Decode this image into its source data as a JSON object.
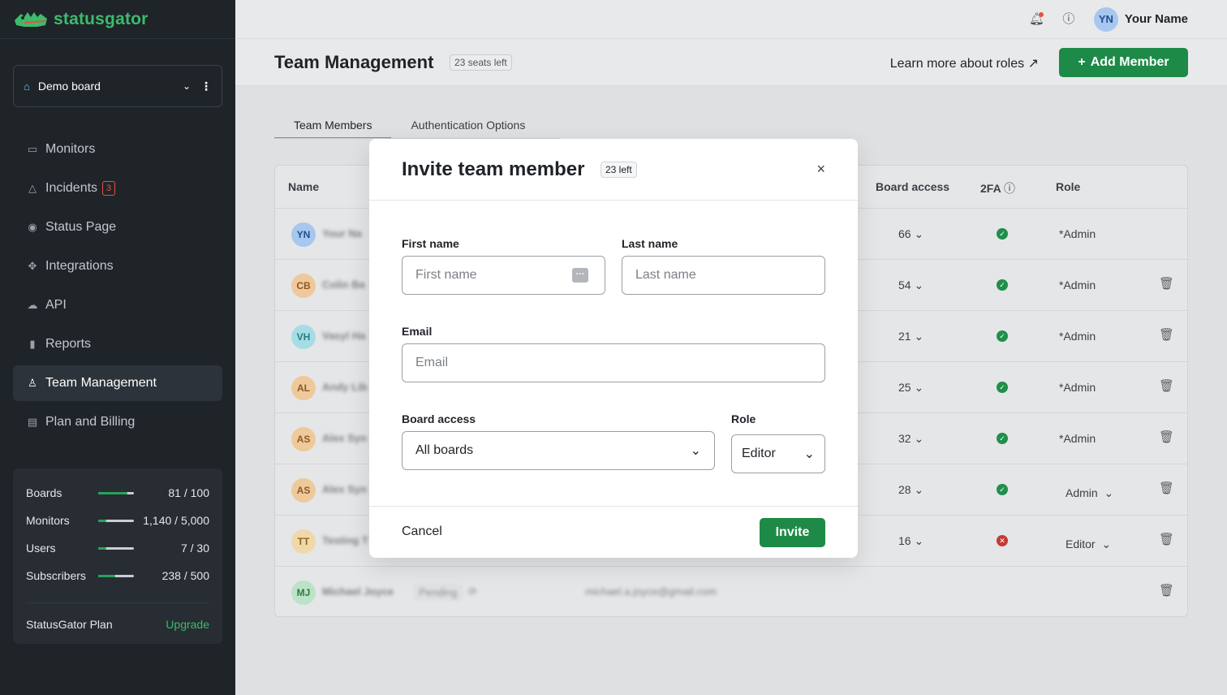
{
  "brand": {
    "name": "statusgator",
    "color": "#3dbb6b"
  },
  "sidebar": {
    "board_select": {
      "label": "Demo board"
    },
    "nav": [
      {
        "label": "Monitors",
        "icon": "monitor-icon"
      },
      {
        "label": "Incidents",
        "icon": "warning-icon",
        "badge": "3"
      },
      {
        "label": "Status Page",
        "icon": "broadcast-icon"
      },
      {
        "label": "Integrations",
        "icon": "puzzle-icon"
      },
      {
        "label": "API",
        "icon": "cloud-icon"
      },
      {
        "label": "Reports",
        "icon": "bar-chart-icon"
      },
      {
        "label": "Team Management",
        "icon": "user-icon",
        "active": true
      },
      {
        "label": "Plan and Billing",
        "icon": "credit-card-icon"
      }
    ],
    "usage": [
      {
        "label": "Boards",
        "value": "81 / 100",
        "fraction": 0.81
      },
      {
        "label": "Monitors",
        "value": "1,140 / 5,000",
        "fraction": 0.23
      },
      {
        "label": "Users",
        "value": "7 / 30",
        "fraction": 0.23
      },
      {
        "label": "Subscribers",
        "value": "238 / 500",
        "fraction": 0.48
      }
    ],
    "plan": {
      "label": "StatusGator Plan",
      "upgrade": "Upgrade"
    }
  },
  "topbar": {
    "user_initials": "YN",
    "user_name": "Your Name"
  },
  "header": {
    "title": "Team Management",
    "seats": "23 seats left",
    "learn_more": "Learn more about roles",
    "add_member": "Add Member"
  },
  "tabs": [
    "Team Members",
    "Authentication Options"
  ],
  "table": {
    "columns": {
      "name": "Name",
      "board_access": "Board access",
      "tfa": "2FA",
      "role": "Role"
    },
    "rows": [
      {
        "initials": "YN",
        "name": "Your Na",
        "access": "66",
        "tfa": true,
        "role": "*Admin"
      },
      {
        "initials": "CB",
        "name": "Colin Ba",
        "access": "54",
        "tfa": true,
        "role": "*Admin"
      },
      {
        "initials": "VH",
        "name": "Vasyl Ha",
        "access": "21",
        "tfa": true,
        "role": "*Admin"
      },
      {
        "initials": "AL",
        "name": "Andy Lib",
        "access": "25",
        "tfa": true,
        "role": "*Admin"
      },
      {
        "initials": "AS",
        "name": "Alex Syn",
        "access": "32",
        "tfa": true,
        "role": "*Admin"
      },
      {
        "initials": "AS",
        "name": "Alex Syn",
        "access": "28",
        "tfa": true,
        "role": "Admin"
      },
      {
        "initials": "TT",
        "name": "Testing T",
        "access": "16",
        "tfa": false,
        "role": "Editor"
      },
      {
        "initials": "MJ",
        "name": "Michael Joyce",
        "status": "Pending",
        "email": "michael.a.joyce@gmail.com"
      }
    ]
  },
  "modal": {
    "title": "Invite team member",
    "left_badge": "23 left",
    "first_name": {
      "label": "First name",
      "placeholder": "First name"
    },
    "last_name": {
      "label": "Last name",
      "placeholder": "Last name"
    },
    "email": {
      "label": "Email",
      "placeholder": "Email"
    },
    "board_access": {
      "label": "Board access",
      "value": "All boards"
    },
    "role": {
      "label": "Role",
      "value": "Editor"
    },
    "cancel": "Cancel",
    "invite": "Invite"
  }
}
